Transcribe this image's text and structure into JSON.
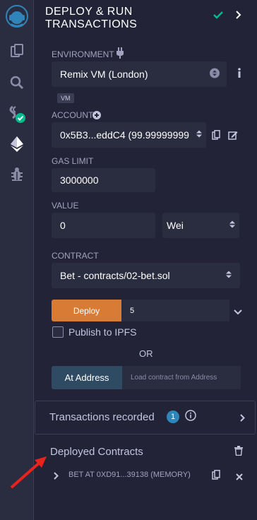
{
  "icons": {
    "logo": "remix-logo-icon",
    "file_explorer": "files-icon",
    "search": "search-icon",
    "compiler": "compiler-icon",
    "deploy": "ethereum-icon",
    "debugger": "bug-icon"
  },
  "header": {
    "title_line1": "DEPLOY & RUN",
    "title_line2": "TRANSACTIONS"
  },
  "environment": {
    "label": "ENVIRONMENT",
    "value": "Remix VM (London)",
    "badge": "VM"
  },
  "account": {
    "label": "ACCOUNT",
    "value": "0x5B3...eddC4 (99.99999999"
  },
  "gas_limit": {
    "label": "GAS LIMIT",
    "value": "3000000"
  },
  "value": {
    "label": "VALUE",
    "amount": "0",
    "unit": "Wei"
  },
  "contract": {
    "label": "CONTRACT",
    "value": "Bet - contracts/02-bet.sol"
  },
  "deploy": {
    "button": "Deploy",
    "input": "5"
  },
  "publish": {
    "label": "Publish to IPFS"
  },
  "or_text": "OR",
  "at_address": {
    "button": "At Address",
    "placeholder": "Load contract from Address"
  },
  "transactions": {
    "label": "Transactions recorded",
    "count": "1"
  },
  "deployed": {
    "label": "Deployed Contracts",
    "instance": "BET AT 0XD91...39138 (MEMORY)"
  },
  "colors": {
    "accent_orange": "#d87c35",
    "success_green": "#00bc8c",
    "badge_blue": "#2f84b9",
    "arrow_red": "#e8231e"
  }
}
